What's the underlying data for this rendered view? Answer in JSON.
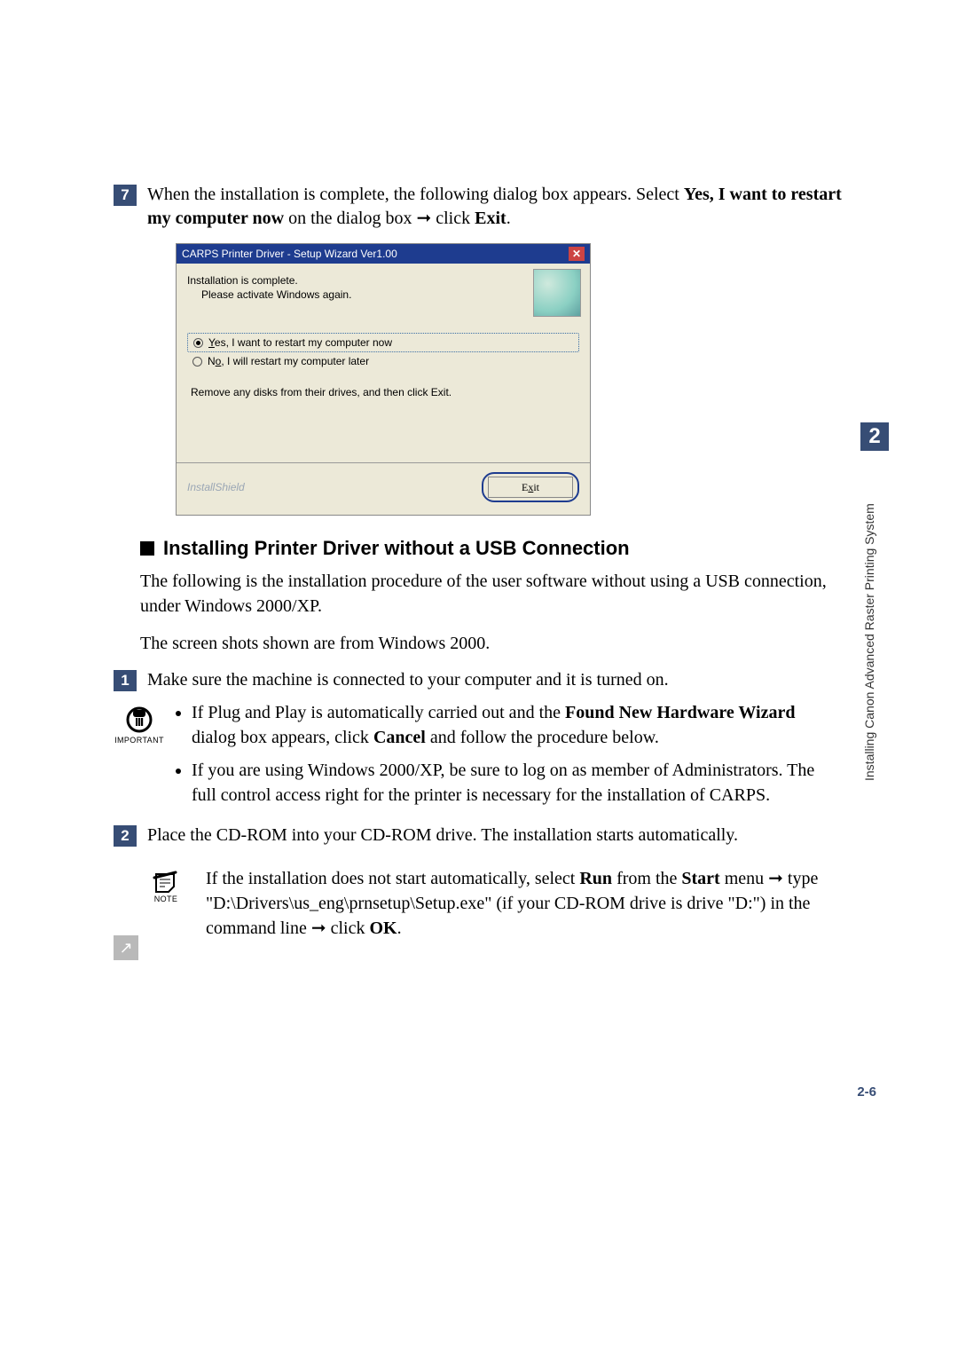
{
  "chapter_number": "2",
  "side_label": "Installing Canon Advanced Raster Printing System",
  "page_number_label": "2-6",
  "step7": {
    "num": "7",
    "text_pre": "When the installation is complete, the following dialog box appears. Select ",
    "bold1": "Yes, I want to restart my computer now",
    "text_mid": " on the dialog box ➞ click ",
    "bold2": "Exit",
    "text_post": "."
  },
  "dialog": {
    "title": "CARPS Printer Driver - Setup Wizard Ver1.00",
    "close_icon": "✕",
    "line1": "Installation is complete.",
    "line2": "Please activate Windows again.",
    "radio_yes_u": "Y",
    "radio_yes_rest": "es, I want to restart my computer now",
    "radio_no_u": "o",
    "radio_no_pre": "N",
    "radio_no_rest": ", I will restart my computer later",
    "remove_text": "Remove any disks from their drives, and then click Exit.",
    "brand": "InstallShield",
    "exit_u": "x",
    "exit_rest_pre": "E",
    "exit_rest_post": "it"
  },
  "subheading": "Installing Printer Driver without a USB Connection",
  "para1": "The following is the installation procedure of the user software without using a USB connection, under Windows 2000/XP.",
  "para2": "The screen shots shown are from Windows 2000.",
  "step1": {
    "num": "1",
    "text": "Make sure the machine is connected to your computer and it is turned on."
  },
  "important_label": "IMPORTANT",
  "important_bullets": {
    "b1_pre": "If Plug and Play is automatically carried out and the ",
    "b1_bold1": "Found New Hardware Wizard",
    "b1_mid": " dialog box appears, click ",
    "b1_bold2": "Cancel",
    "b1_post": " and follow the procedure below.",
    "b2": "If you are using Windows 2000/XP, be sure to log on as member of Administrators. The full control access right for the printer is necessary for the installation of CARPS."
  },
  "step2": {
    "num": "2",
    "text": "Place the CD-ROM into your CD-ROM drive. The installation starts automatically."
  },
  "note_label": "NOTE",
  "note": {
    "pre": "If the installation does not start automatically, select ",
    "bold1": "Run",
    "mid1": " from the ",
    "bold2": "Start",
    "mid2": " menu ➞ type \"D:\\Drivers\\us_eng\\prnsetup\\Setup.exe\" (if your CD-ROM drive is drive \"D:\") in the command line ➞ click ",
    "bold3": "OK",
    "post": "."
  },
  "back_arrow": "↗"
}
